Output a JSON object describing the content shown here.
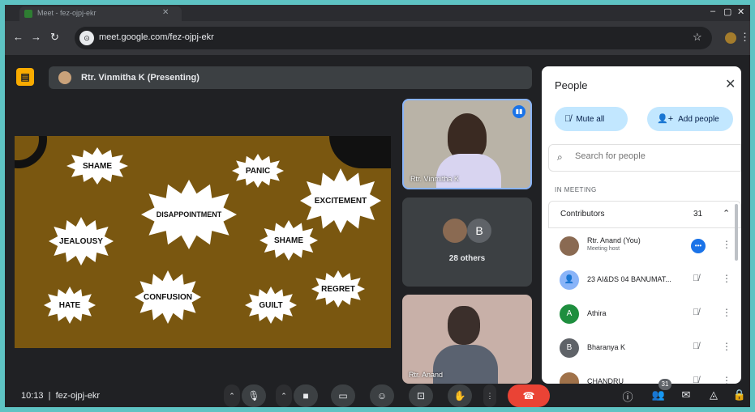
{
  "browser": {
    "tab_title": "Meet - fez-ojpj-ekr",
    "url": "meet.google.com/fez-ojpj-ekr"
  },
  "meet": {
    "presenting_label": "Rtr. Vinmitha K (Presenting)"
  },
  "slide": {
    "words": [
      "SHAME",
      "PANIC",
      "EXCITEMENT",
      "DISAPPOINTMENT",
      "JEALOUSY",
      "SHAME",
      "REGRET",
      "CONFUSION",
      "HATE",
      "GUILT"
    ],
    "colors": {
      "background": "#7a5710",
      "burst": "#ffffff"
    }
  },
  "tiles": {
    "presenter_name": "Rtr. Vinmitha K",
    "others_initial": "B",
    "others_label": "28 others",
    "bottom_name": "Rtr. Anand"
  },
  "bottom_bar": {
    "time": "10:13",
    "meeting_code": "fez-ojpj-ekr",
    "people_count": "31"
  },
  "people_panel": {
    "title": "People",
    "mute_all": "Mute all",
    "add_people": "Add people",
    "search_placeholder": "Search for people",
    "section": "IN MEETING",
    "contributors_label": "Contributors",
    "contributors_count": "31",
    "participants": [
      {
        "name": "Rtr. Anand (You)",
        "sub": "Meeting host",
        "initial": "",
        "color": "#8a6a52"
      },
      {
        "name": "23 AI&DS 04 BANUMAT...",
        "sub": "",
        "initial": "",
        "color": "#8ab4f8"
      },
      {
        "name": "Athira",
        "sub": "",
        "initial": "A",
        "color": "#1e8e3e"
      },
      {
        "name": "Bharanya K",
        "sub": "",
        "initial": "B",
        "color": "#5f6368"
      },
      {
        "name": "CHANDRU",
        "sub": "",
        "initial": "",
        "color": "#a0724a"
      }
    ]
  }
}
